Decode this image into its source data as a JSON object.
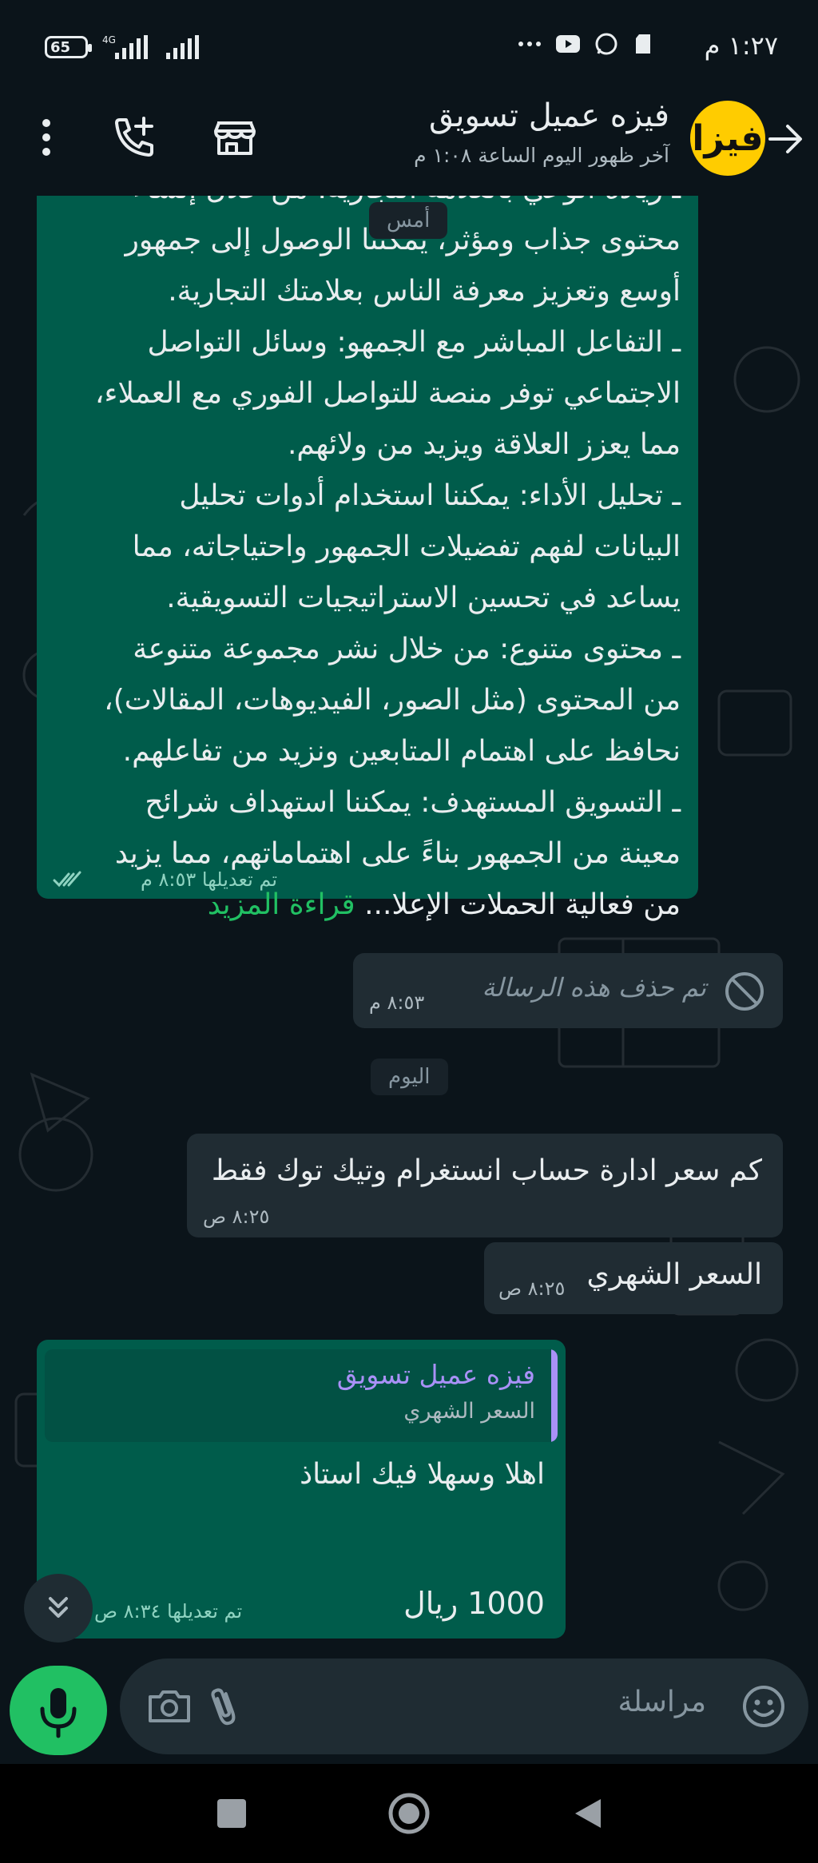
{
  "status_bar": {
    "time": "١:٢٧ م",
    "battery": "65",
    "network": "4G"
  },
  "header": {
    "title": "فيزه عميل تسويق",
    "subtitle": "آخر ظهور اليوم الساعة ١:٠٨ م",
    "avatar_text": "فيزا",
    "avatar_color": "#ffcc00"
  },
  "messages": {
    "big": {
      "lines": [
        "ـ زيادة الوعي بالعلامة التجارية: من خلال إنشاء",
        "محتوى جذاب ومؤثر، يمكننا الوصول إلى جمهور",
        "أوسع وتعزيز معرفة الناس بعلامتك التجارية.",
        "ـ التفاعل المباشر مع الجمهو: وسائل التواصل",
        "الاجتماعي توفر منصة للتواصل الفوري مع العملاء،",
        "مما يعزز العلاقة ويزيد من ولائهم.",
        "ـ تحليل الأداء: يمكننا استخدام أدوات تحليل",
        "البيانات لفهم تفضيلات الجمهور واحتياجاته، مما",
        "يساعد في تحسين الاستراتيجيات التسويقية.",
        "ـ محتوى متنوع: من خلال نشر مجموعة متنوعة",
        "من المحتوى (مثل الصور، الفيديوهات، المقالات)،",
        "نحافظ على اهتمام المتابعين ونزيد من تفاعلهم.",
        "ـ التسويق المستهدف: يمكننا استهداف شرائح",
        "معينة من الجمهور بناءً على اهتماماتهم، مما يزيد"
      ],
      "last_line": "من فعالية الحملات الإعلا...",
      "read_more": "قراءة المزيد",
      "meta": "تم تعديلها ٨:٥٣ م"
    },
    "date_yesterday": "أمس",
    "deleted": {
      "text": "تم حذف هذه الرسالة",
      "time": "٨:٥٣ م"
    },
    "date_today": "اليوم",
    "in1": {
      "text": "كم سعر ادارة حساب انستغرام وتيك توك فقط",
      "time": "٨:٢٥ ص"
    },
    "in2": {
      "text": "السعر الشهري",
      "time": "٨:٢٥ ص"
    },
    "reply": {
      "quote_name": "فيزه عميل تسويق",
      "quote_text": "السعر الشهري",
      "line1": "اهلا وسهلا فيك استاذ",
      "line2": "1000 ريال",
      "meta": "تم تعديلها ٨:٣٤ ص"
    }
  },
  "input": {
    "placeholder": "مراسلة"
  },
  "colors": {
    "accent": "#21c063",
    "outgoing": "#005c4b",
    "incoming": "#202c33",
    "background": "#0b141a"
  }
}
